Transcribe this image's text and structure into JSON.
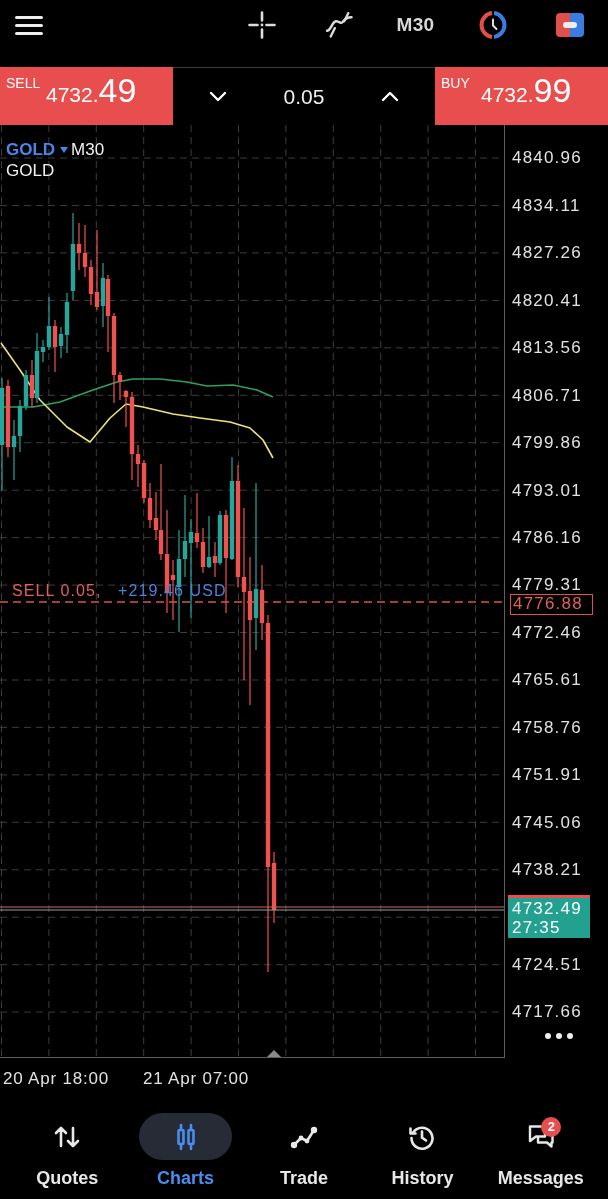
{
  "top_bar": {
    "timeframe": "M30"
  },
  "trade_panel": {
    "sell": {
      "label": "SELL",
      "price": "4732.**49**"
    },
    "volume": "0.05",
    "buy": {
      "label": "BUY",
      "price": "4732.**99**"
    }
  },
  "chart": {
    "symbol": "GOLD",
    "timeframe": "M30",
    "description": "GOLD",
    "position": {
      "label": "SELL 0.05,",
      "profit": "+219.46 USD",
      "price": "4776.88"
    },
    "price_axis": [
      {
        "kind": "tick",
        "label": "4840.96"
      },
      {
        "kind": "tick",
        "label": "4834.11"
      },
      {
        "kind": "tick",
        "label": "4827.26"
      },
      {
        "kind": "tick",
        "label": "4820.41"
      },
      {
        "kind": "tick",
        "label": "4813.56"
      },
      {
        "kind": "tick",
        "label": "4806.71"
      },
      {
        "kind": "tick",
        "label": "4799.86"
      },
      {
        "kind": "tick",
        "label": "4793.01"
      },
      {
        "kind": "tick",
        "label": "4786.16"
      },
      {
        "kind": "tick",
        "label": "4779.31"
      },
      {
        "kind": "tick",
        "label": "4772.46"
      },
      {
        "kind": "tick",
        "label": "4765.61"
      },
      {
        "kind": "tick",
        "label": "4758.76"
      },
      {
        "kind": "tick",
        "label": "4751.91"
      },
      {
        "kind": "tick",
        "label": "4745.06"
      },
      {
        "kind": "tick",
        "label": "4738.21"
      },
      {
        "kind": "current",
        "price": "4732.49",
        "countdown": "27:35"
      },
      {
        "kind": "tick",
        "label": "4724.51"
      },
      {
        "kind": "tick",
        "label": "4717.66"
      }
    ],
    "time_axis": [
      "20 Apr 18:00",
      "21 Apr 07:00"
    ]
  },
  "bottom_nav": [
    {
      "label": "Quotes",
      "selected": false
    },
    {
      "label": "Charts",
      "selected": true
    },
    {
      "label": "Trade",
      "selected": false
    },
    {
      "label": "History",
      "selected": false
    },
    {
      "label": "Messages",
      "selected": false,
      "badge": "2"
    }
  ]
}
